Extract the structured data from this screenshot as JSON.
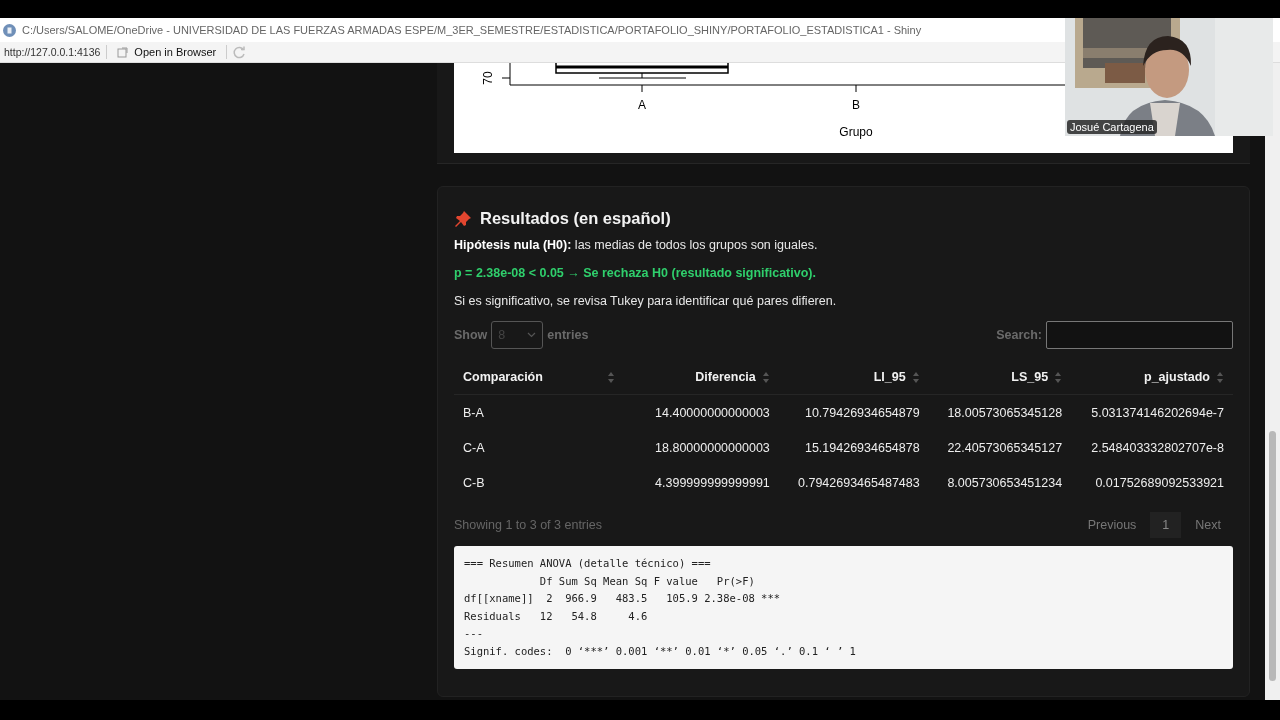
{
  "window": {
    "title": "C:/Users/SALOME/OneDrive - UNIVERSIDAD DE LAS FUERZAS ARMADAS ESPE/M_3ER_SEMESTRE/ESTADISTICA/PORTAFOLIO_SHINY/PORTAFOLIO_ESTADISTICA1 - Shiny"
  },
  "toolbar": {
    "url": "http://127.0.0.1:4136",
    "open_button": "Open in Browser"
  },
  "plot": {
    "y_tick": "70",
    "x_ticks": [
      "A",
      "B"
    ],
    "xlabel": "Grupo"
  },
  "results": {
    "title": "Resultados (en español)",
    "hypothesis": "**Hipótesis nula (H0):** las medias de todos los grupos son iguales.",
    "verdict": "p = 2.38e-08 < 0.05 → Se rechaza H0 (resultado significativo).",
    "note": "Si es significativo, se revisa Tukey para identificar qué pares difieren."
  },
  "table_controls": {
    "show_label": "Show",
    "page_length": "8",
    "entries_label": "entries",
    "search_label": "Search:"
  },
  "table": {
    "columns": [
      "Comparación",
      "Diferencia",
      "LI_95",
      "LS_95",
      "p_ajustado"
    ],
    "rows": [
      [
        "B-A",
        "14.40000000000003",
        "10.79426934654879",
        "18.00573065345128",
        "5.031374146202694e-7"
      ],
      [
        "C-A",
        "18.80000000000003",
        "15.19426934654878",
        "22.40573065345127",
        "2.548403332802707e-8"
      ],
      [
        "C-B",
        "4.399999999999991",
        "0.7942693465487483",
        "8.005730653451234",
        "0.01752689092533921"
      ]
    ]
  },
  "table_footer": {
    "info": "Showing 1 to 3 of 3 entries",
    "previous": "Previous",
    "page": "1",
    "next": "Next"
  },
  "anova_output": "=== Resumen ANOVA (detalle técnico) ===\n            Df Sum Sq Mean Sq F value   Pr(>F)    \ndf[[xname]]  2  966.9   483.5   105.9 2.38e-08 ***\nResiduals   12   54.8     4.6                     \n---\nSignif. codes:  0 ‘***’ 0.001 ‘**’ 0.01 ‘*’ 0.05 ‘.’ 0.1 ‘ ’ 1",
  "webcam": {
    "name": "Josué Cartagena"
  }
}
